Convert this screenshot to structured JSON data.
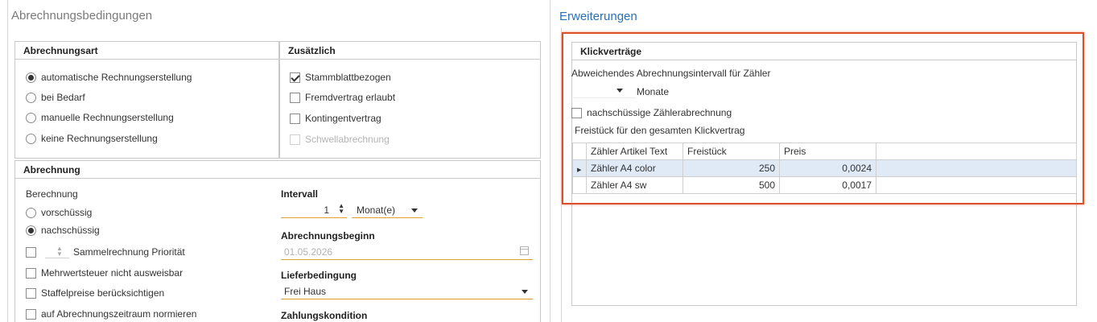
{
  "left": {
    "title": "Abrechnungsbedingungen",
    "abrechnungsart": {
      "header": "Abrechnungsart",
      "options": [
        {
          "label": "automatische Rechnungserstellung",
          "selected": true
        },
        {
          "label": "bei Bedarf",
          "selected": false
        },
        {
          "label": "manuelle Rechnungserstellung",
          "selected": false
        },
        {
          "label": "keine Rechnungserstellung",
          "selected": false
        }
      ]
    },
    "zusaetzlich": {
      "header": "Zusätzlich",
      "items": [
        {
          "label": "Stammblattbezogen",
          "checked": true,
          "disabled": false
        },
        {
          "label": "Fremdvertrag erlaubt",
          "checked": false,
          "disabled": false
        },
        {
          "label": "Kontingentvertrag",
          "checked": false,
          "disabled": false
        },
        {
          "label": "Schwellabrechnung",
          "checked": false,
          "disabled": true
        }
      ]
    },
    "abrechnung": {
      "header": "Abrechnung",
      "berechnung_label": "Berechnung",
      "berechnung_options": [
        {
          "label": "vorschüssig",
          "selected": false
        },
        {
          "label": "nachschüssig",
          "selected": true
        }
      ],
      "sammelrechnung_label": "Sammelrechnung Priorität",
      "checks": [
        {
          "label": "Mehrwertsteuer nicht ausweisbar",
          "checked": false
        },
        {
          "label": "Staffelpreise berücksichtigen",
          "checked": false
        },
        {
          "label": "auf Abrechnungszeitraum normieren",
          "checked": false
        }
      ],
      "intervall_label": "Intervall",
      "intervall_value": "1",
      "intervall_unit": "Monat(e)",
      "beginn_label": "Abrechnungsbeginn",
      "beginn_value": "01.05.2026",
      "lieferbedingung_label": "Lieferbedingung",
      "lieferbedingung_value": "Frei Haus",
      "zahlungskondition_label": "Zahlungskondition"
    }
  },
  "right": {
    "title": "Erweiterungen",
    "klick": {
      "header": "Klickverträge",
      "abw_label": "Abweichendes Abrechnungsintervall für Zähler",
      "monate_label": "Monate",
      "nachschuessig_label": "nachschüssige Zählerabrechnung",
      "freistueck_label": "Freistück für den gesamten Klickvertrag",
      "columns": [
        "Zähler Artikel Text",
        "Freistück",
        "Preis"
      ],
      "rows": [
        {
          "text": "Zähler A4 color",
          "freistueck": "250",
          "preis": "0,0024",
          "selected": true
        },
        {
          "text": "Zähler A4 sw",
          "freistueck": "500",
          "preis": "0,0017",
          "selected": false
        }
      ]
    }
  },
  "colors": {
    "accent": "#2b6fb6",
    "highlight": "#d9502a",
    "field_underline": "#e0a030",
    "selected_row": "#dfeaf6"
  }
}
